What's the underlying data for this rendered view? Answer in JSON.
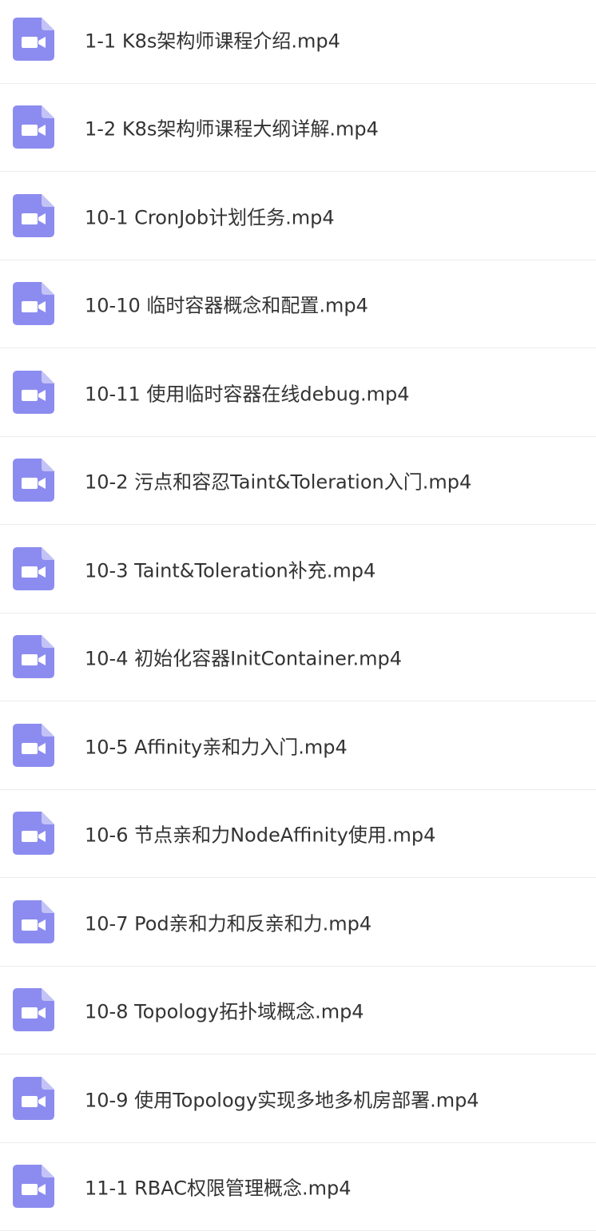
{
  "colors": {
    "icon_bg": "#8c8cf0",
    "icon_fold": "#c3c3f7",
    "icon_glyph": "#ffffff",
    "text": "#333333",
    "divider": "#ececec"
  },
  "files": [
    {
      "name": "1-1 K8s架构师课程介绍.mp4",
      "icon": "video-file-icon"
    },
    {
      "name": "1-2 K8s架构师课程大纲详解.mp4",
      "icon": "video-file-icon"
    },
    {
      "name": "10-1 CronJob计划任务.mp4",
      "icon": "video-file-icon"
    },
    {
      "name": "10-10 临时容器概念和配置.mp4",
      "icon": "video-file-icon"
    },
    {
      "name": "10-11 使用临时容器在线debug.mp4",
      "icon": "video-file-icon"
    },
    {
      "name": "10-2 污点和容忍Taint&Toleration入门.mp4",
      "icon": "video-file-icon"
    },
    {
      "name": "10-3 Taint&Toleration补充.mp4",
      "icon": "video-file-icon"
    },
    {
      "name": "10-4 初始化容器InitContainer.mp4",
      "icon": "video-file-icon"
    },
    {
      "name": "10-5 Affinity亲和力入门.mp4",
      "icon": "video-file-icon"
    },
    {
      "name": "10-6 节点亲和力NodeAffinity使用.mp4",
      "icon": "video-file-icon"
    },
    {
      "name": "10-7 Pod亲和力和反亲和力.mp4",
      "icon": "video-file-icon"
    },
    {
      "name": "10-8 Topology拓扑域概念.mp4",
      "icon": "video-file-icon"
    },
    {
      "name": "10-9 使用Topology实现多地多机房部署.mp4",
      "icon": "video-file-icon"
    },
    {
      "name": "11-1 RBAC权限管理概念.mp4",
      "icon": "video-file-icon"
    }
  ]
}
